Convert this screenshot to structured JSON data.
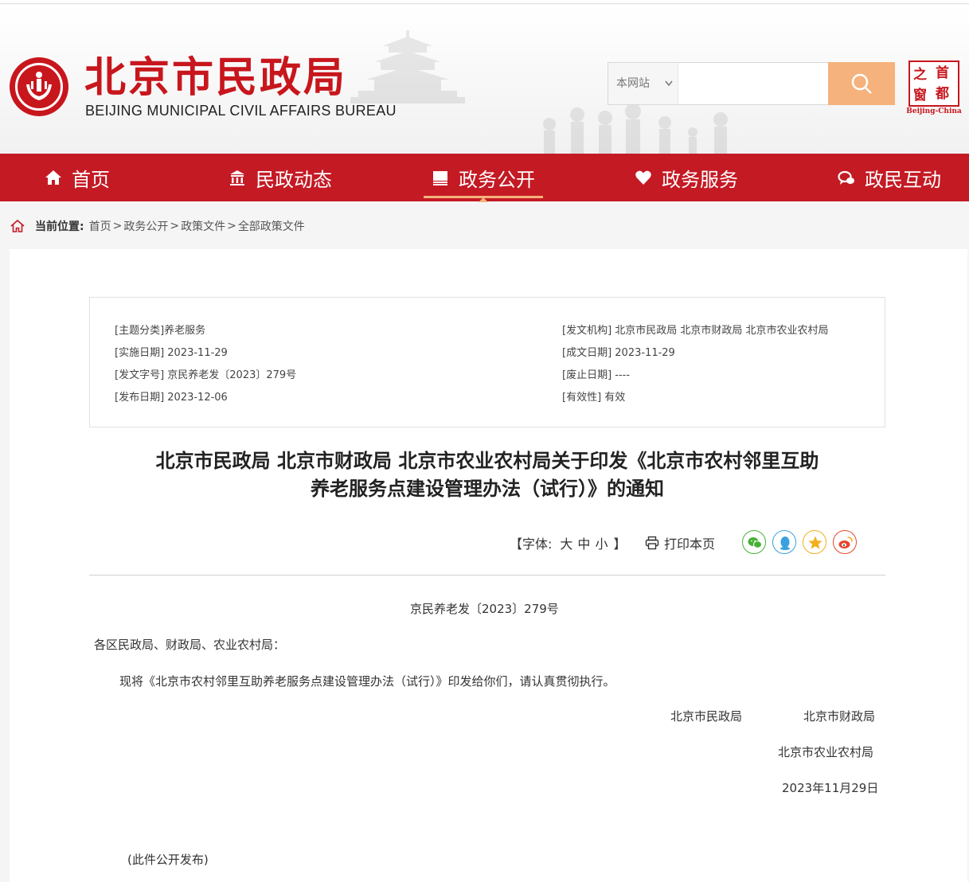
{
  "header": {
    "logo_cn": "北京市民政局",
    "logo_en": "BEIJING MUNICIPAL CIVIL AFFAIRS BUREAU",
    "search_scope": "本网站",
    "search_placeholder": "",
    "capital_chars": [
      "之",
      "首",
      "窗",
      "都"
    ],
    "capital_sub": "Beijing-China"
  },
  "nav": {
    "items": [
      {
        "label": "首页",
        "icon": "home-icon"
      },
      {
        "label": "民政动态",
        "icon": "building-icon"
      },
      {
        "label": "政务公开",
        "icon": "book-icon",
        "active": true
      },
      {
        "label": "政务服务",
        "icon": "heart-icon"
      },
      {
        "label": "政民互动",
        "icon": "chat-icon"
      }
    ]
  },
  "breadcrumb": {
    "label": "当前位置:",
    "items": [
      "首页",
      "政务公开",
      "政策文件",
      "全部政策文件"
    ],
    "sep": ">"
  },
  "meta": {
    "left": [
      "[主题分类]养老服务",
      "[实施日期] 2023-11-29",
      "[发文字号] 京民养老发〔2023〕279号",
      "[发布日期] 2023-12-06"
    ],
    "right": [
      "[发文机构] 北京市民政局 北京市财政局 北京市农业农村局",
      "[成文日期] 2023-11-29",
      "[废止日期] ----",
      "[有效性] 有效"
    ]
  },
  "article": {
    "title_line1": "北京市民政局 北京市财政局 北京市农业农村局关于印发《北京市农村邻里互助",
    "title_line2": "养老服务点建设管理办法（试行）》的通知",
    "font_label": "【字体:",
    "font_large": "大",
    "font_medium": "中",
    "font_small": "小",
    "font_close": "】",
    "print_label": "打印本页",
    "doc_number": "京民养老发〔2023〕279号",
    "recipients": "各区民政局、财政局、农业农村局：",
    "paragraph": "现将《北京市农村邻里互助养老服务点建设管理办法（试行）》印发给你们，请认真贯彻执行。",
    "sign_1": "北京市民政局",
    "sign_2": "北京市财政局",
    "sign_3": "北京市农业农村局",
    "date": "2023年11月29日",
    "note": "(此件公开发布)"
  },
  "colors": {
    "brand_red": "#c41a24",
    "search_orange": "#f5b27c",
    "wechat_green": "#46b035",
    "qq_blue": "#3aa0e0",
    "qzone_yellow": "#f2b01e",
    "weibo_red": "#e6452e"
  }
}
